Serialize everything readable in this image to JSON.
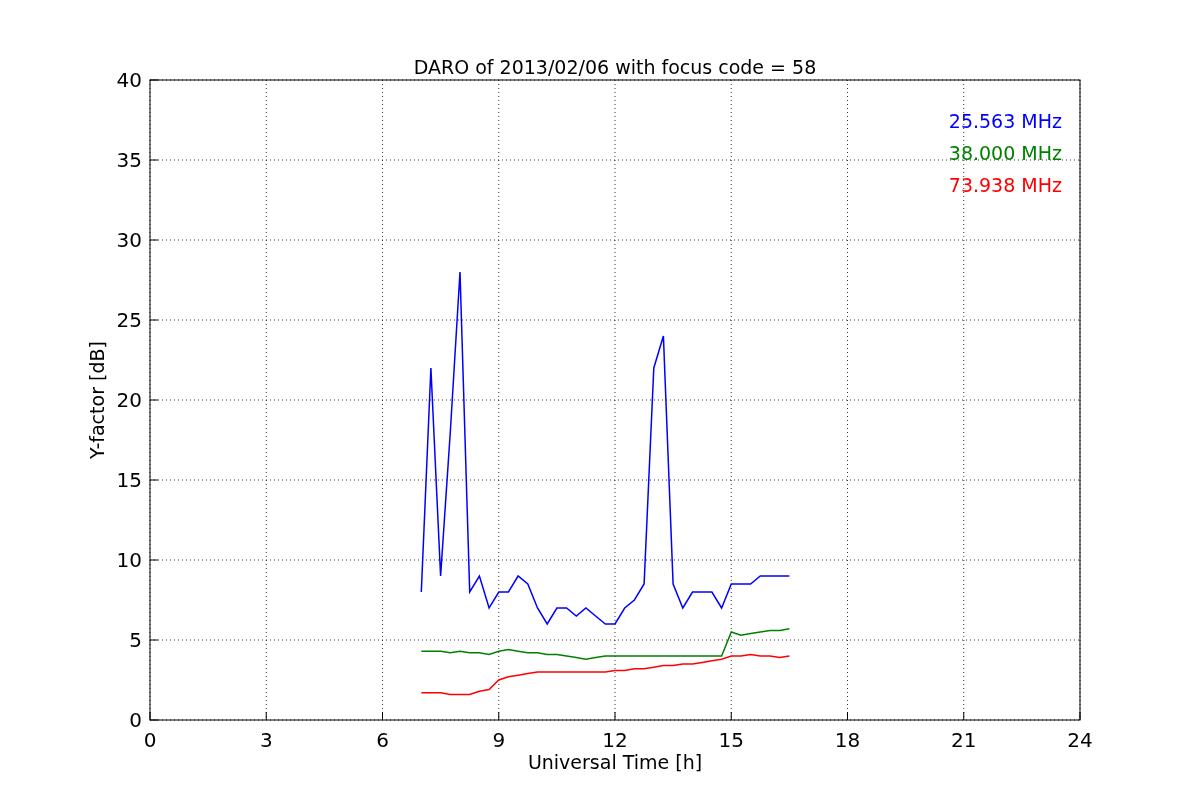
{
  "figure": {
    "chart_data": {
      "type": "line",
      "title": "DARO of 2013/02/06 with focus code = 58",
      "xlabel": "Universal Time [h]",
      "ylabel": "Y-factor [dB]",
      "grid": true,
      "xlim": [
        0,
        24
      ],
      "ylim": [
        0,
        40
      ],
      "xticks": [
        0,
        3,
        6,
        9,
        12,
        15,
        18,
        21,
        24
      ],
      "yticks": [
        0,
        5,
        10,
        15,
        20,
        25,
        30,
        35,
        40
      ],
      "x": [
        7,
        7.25,
        7.5,
        7.75,
        8,
        8.25,
        8.5,
        8.75,
        9,
        9.25,
        9.5,
        9.75,
        10,
        10.25,
        10.5,
        10.75,
        11,
        11.25,
        11.5,
        11.75,
        12,
        12.25,
        12.5,
        12.75,
        13,
        13.25,
        13.5,
        13.75,
        14,
        14.25,
        14.5,
        14.75,
        15,
        15.25,
        15.5,
        15.75,
        16,
        16.25,
        16.5
      ],
      "series": [
        {
          "name": "25.563 MHz",
          "color": "#0000ff",
          "values": [
            8,
            22,
            9,
            18,
            28,
            8,
            9,
            7,
            8,
            8,
            9,
            8.5,
            7,
            6,
            7,
            7,
            6.5,
            7,
            6.5,
            6,
            6,
            7,
            7.5,
            8.5,
            22,
            24,
            8.5,
            7,
            8,
            8,
            8,
            7,
            8.5,
            8.5,
            8.5,
            9,
            9,
            9,
            9
          ]
        },
        {
          "name": "38.000 MHz",
          "color": "#008000",
          "values": [
            4.3,
            4.3,
            4.3,
            4.2,
            4.3,
            4.2,
            4.2,
            4.1,
            4.3,
            4.4,
            4.3,
            4.2,
            4.2,
            4.1,
            4.1,
            4,
            3.9,
            3.8,
            3.9,
            4,
            4,
            4,
            4,
            4,
            4,
            4,
            4,
            4,
            4,
            4,
            4,
            4,
            5.5,
            5.3,
            5.4,
            5.5,
            5.6,
            5.6,
            5.7
          ]
        },
        {
          "name": "73.938 MHz",
          "color": "#ff0000",
          "values": [
            1.7,
            1.7,
            1.7,
            1.6,
            1.6,
            1.6,
            1.8,
            1.9,
            2.5,
            2.7,
            2.8,
            2.9,
            3,
            3,
            3,
            3,
            3,
            3,
            3,
            3,
            3.1,
            3.1,
            3.2,
            3.2,
            3.3,
            3.4,
            3.4,
            3.5,
            3.5,
            3.6,
            3.7,
            3.8,
            4,
            4,
            4.1,
            4,
            4,
            3.9,
            4
          ]
        }
      ]
    }
  }
}
